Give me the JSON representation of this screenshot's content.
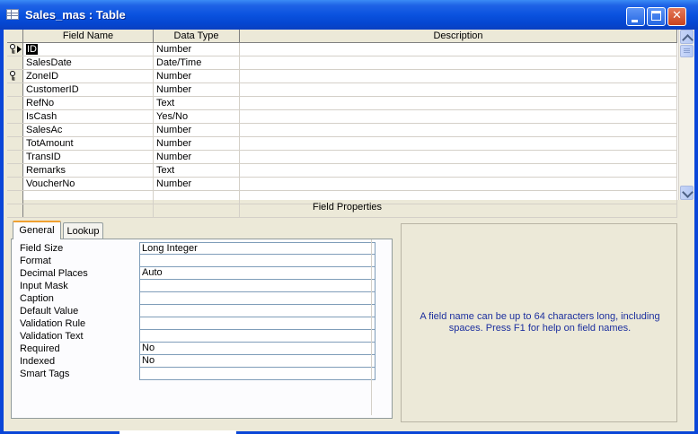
{
  "window": {
    "title": "Sales_mas : Table",
    "minimize_glyph": "",
    "maximize_glyph": "",
    "close_glyph": "✕"
  },
  "grid": {
    "headers": [
      "Field Name",
      "Data Type",
      "Description"
    ],
    "rows": [
      {
        "name": "ID",
        "type": "Number",
        "desc": ""
      },
      {
        "name": "SalesDate",
        "type": "Date/Time",
        "desc": ""
      },
      {
        "name": "ZoneID",
        "type": "Number",
        "desc": ""
      },
      {
        "name": "CustomerID",
        "type": "Number",
        "desc": ""
      },
      {
        "name": "RefNo",
        "type": "Text",
        "desc": ""
      },
      {
        "name": "IsCash",
        "type": "Yes/No",
        "desc": ""
      },
      {
        "name": "SalesAc",
        "type": "Number",
        "desc": ""
      },
      {
        "name": "TotAmount",
        "type": "Number",
        "desc": ""
      },
      {
        "name": "TransID",
        "type": "Number",
        "desc": ""
      },
      {
        "name": "Remarks",
        "type": "Text",
        "desc": ""
      },
      {
        "name": "VoucherNo",
        "type": "Number",
        "desc": ""
      },
      {
        "name": "",
        "type": "",
        "desc": ""
      },
      {
        "name": "",
        "type": "",
        "desc": ""
      }
    ]
  },
  "field_properties": {
    "label": "Field Properties",
    "tabs": [
      "General",
      "Lookup"
    ],
    "properties": [
      {
        "label": "Field Size",
        "value": "Long Integer"
      },
      {
        "label": "Format",
        "value": ""
      },
      {
        "label": "Decimal Places",
        "value": "Auto"
      },
      {
        "label": "Input Mask",
        "value": ""
      },
      {
        "label": "Caption",
        "value": ""
      },
      {
        "label": "Default Value",
        "value": ""
      },
      {
        "label": "Validation Rule",
        "value": ""
      },
      {
        "label": "Validation Text",
        "value": ""
      },
      {
        "label": "Required",
        "value": "No"
      },
      {
        "label": "Indexed",
        "value": "No"
      },
      {
        "label": "Smart Tags",
        "value": ""
      }
    ],
    "help_text": "A field name can be up to 64 characters long, including spaces.  Press F1 for help on field names."
  }
}
